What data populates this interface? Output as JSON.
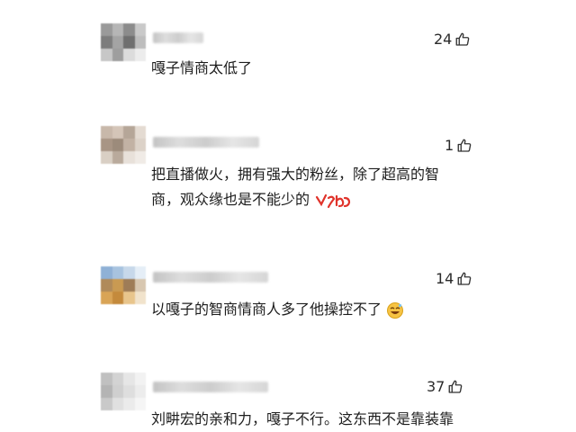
{
  "comments": [
    {
      "likes": "24",
      "text_lines": [
        "嘎子情商太低了"
      ],
      "emoji": null
    },
    {
      "likes": "1",
      "text_lines": [
        "把直播做火，拥有强大的粉丝，除了超高的智",
        "商，观众缘也是不能少的"
      ],
      "emoji": "red-handwriting-emoji"
    },
    {
      "likes": "14",
      "text_lines": [
        "以嘎子的智商情商人多了他操控不了"
      ],
      "emoji": "laughing-face-emoji"
    },
    {
      "likes": "37",
      "text_lines": [
        "刘畊宏的亲和力，嘎子不行。这东西不是靠装靠"
      ],
      "emoji": null
    }
  ],
  "icons": {
    "like": "thumbs-up-icon"
  },
  "colors": {
    "text": "#1d1d1d",
    "likes": "#2a2a2a",
    "emoji_red": "#e0332b",
    "emoji_yellow": "#f6c343"
  }
}
